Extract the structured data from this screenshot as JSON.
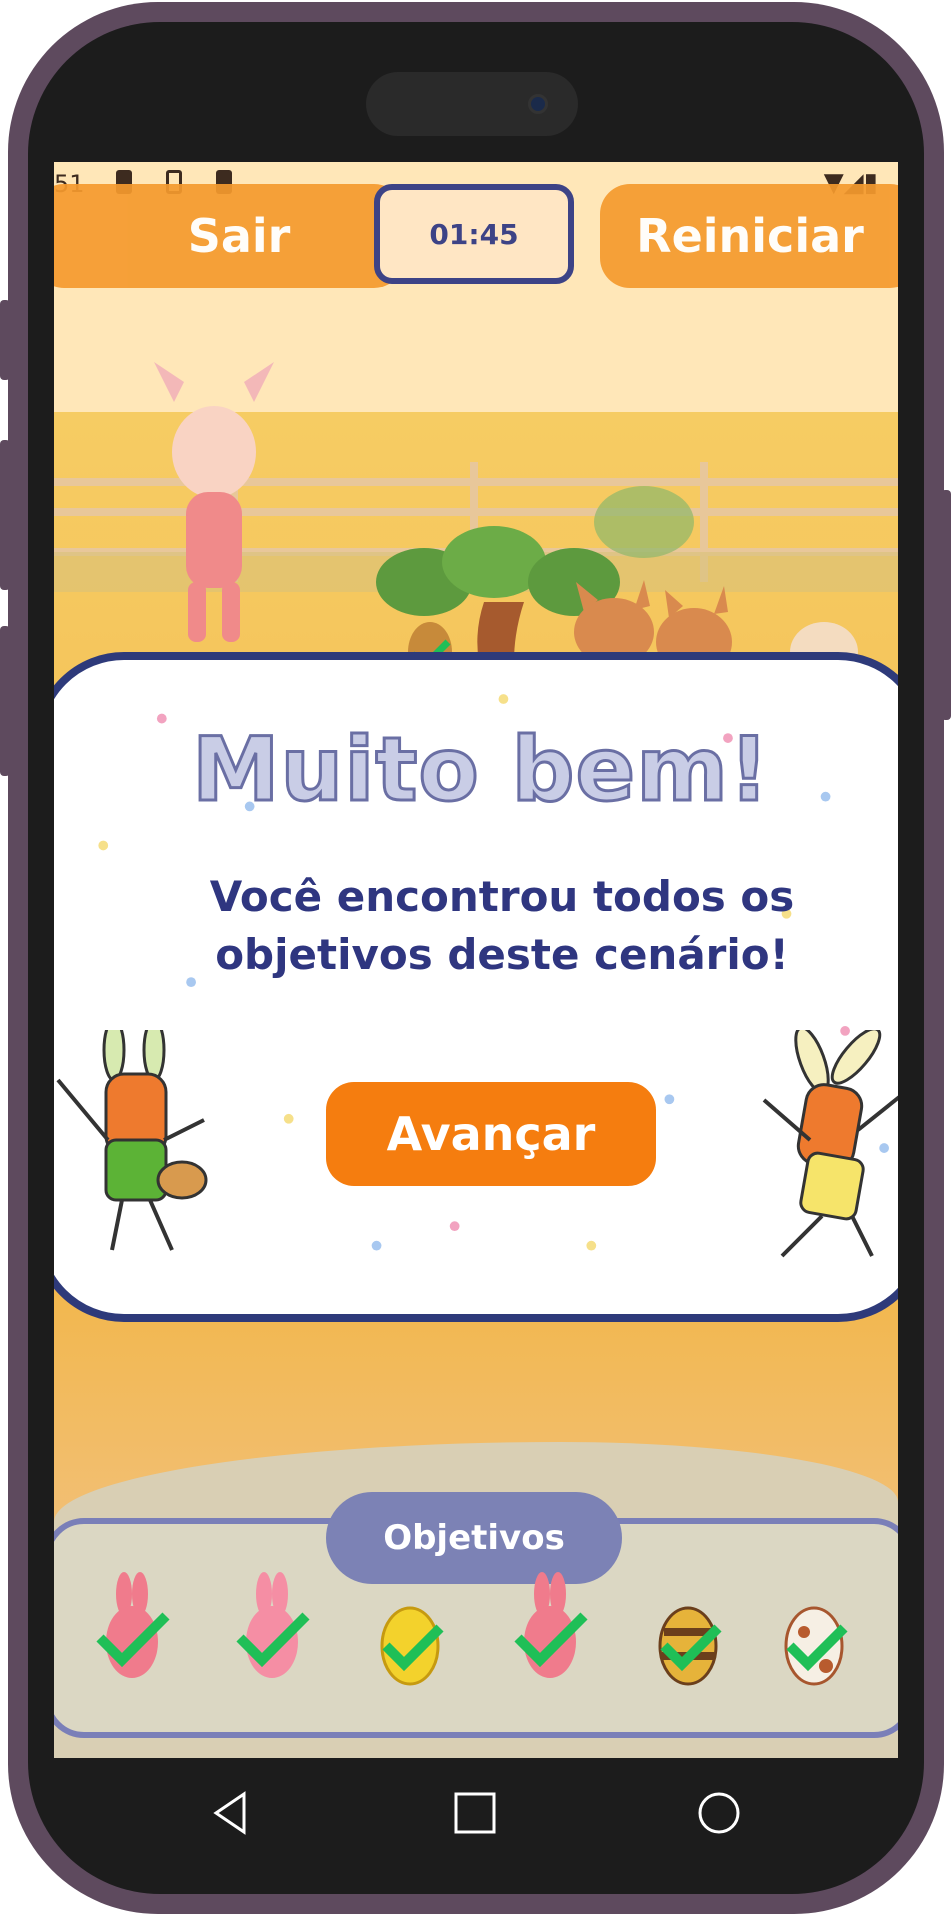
{
  "status_bar": {
    "time": "51"
  },
  "controls": {
    "exit_label": "Sair",
    "restart_label": "Reiniciar",
    "timer": "01:45"
  },
  "modal": {
    "title": "Muito bem!",
    "message": "Você encontrou todos os objetivos deste cenário!",
    "advance_label": "Avançar"
  },
  "objectives": {
    "title": "Objetivos",
    "items": [
      {
        "kind": "pink-bunny",
        "found": true
      },
      {
        "kind": "pink-bunny",
        "found": true
      },
      {
        "kind": "yellow-egg",
        "found": true
      },
      {
        "kind": "pink-bunny",
        "found": true
      },
      {
        "kind": "striped-egg",
        "found": true
      },
      {
        "kind": "spotted-egg",
        "found": true
      }
    ]
  },
  "colors": {
    "accent_orange": "#f57d0f",
    "navy": "#2e3a7a",
    "check_green": "#1fbf57",
    "panel_purple": "#7c82b5"
  },
  "navigation": {
    "buttons": [
      "back-icon",
      "home-icon",
      "recents-icon"
    ]
  }
}
